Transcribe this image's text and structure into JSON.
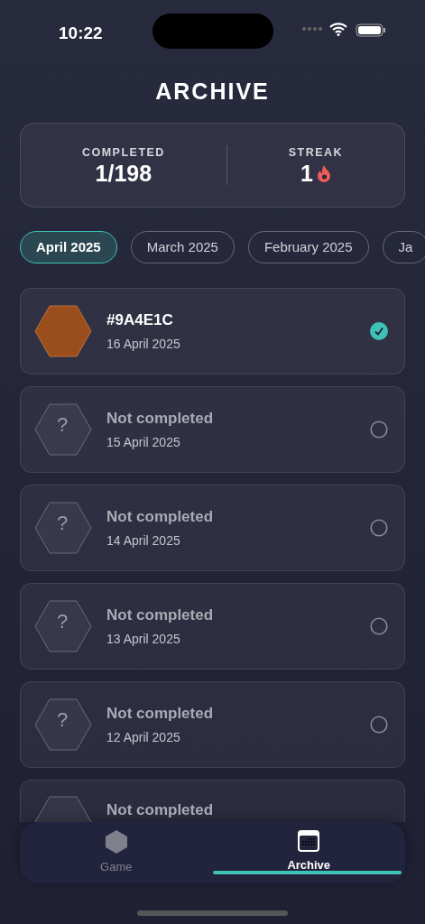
{
  "status_bar": {
    "time": "10:22"
  },
  "title": "ARCHIVE",
  "stats": [
    {
      "label": "COMPLETED",
      "value": "1/198"
    },
    {
      "label": "STREAK",
      "value": "1",
      "flame": true
    }
  ],
  "months": [
    {
      "label": "April 2025",
      "selected": true
    },
    {
      "label": "March 2025",
      "selected": false
    },
    {
      "label": "February 2025",
      "selected": false
    },
    {
      "label": "Ja",
      "selected": false
    }
  ],
  "puzzles": [
    {
      "kind": "solved",
      "title": "#9A4E1C",
      "date": "16 April 2025",
      "completed": true,
      "color": "#9a4e1c"
    },
    {
      "kind": "unsolved",
      "symbol": "?",
      "title": "Not completed",
      "date": "15 April 2025",
      "completed": false
    },
    {
      "kind": "unsolved",
      "symbol": "?",
      "title": "Not completed",
      "date": "14 April 2025",
      "completed": false
    },
    {
      "kind": "unsolved",
      "symbol": "?",
      "title": "Not completed",
      "date": "13 April 2025",
      "completed": false
    },
    {
      "kind": "unsolved",
      "symbol": "?",
      "title": "Not completed",
      "date": "12 April 2025",
      "completed": false
    },
    {
      "kind": "unsolved",
      "title": "Not completed"
    }
  ],
  "tab_bar": [
    {
      "kind": "game",
      "label": "Game",
      "selected": false
    },
    {
      "kind": "archive",
      "label": "Archive",
      "selected": true
    }
  ]
}
